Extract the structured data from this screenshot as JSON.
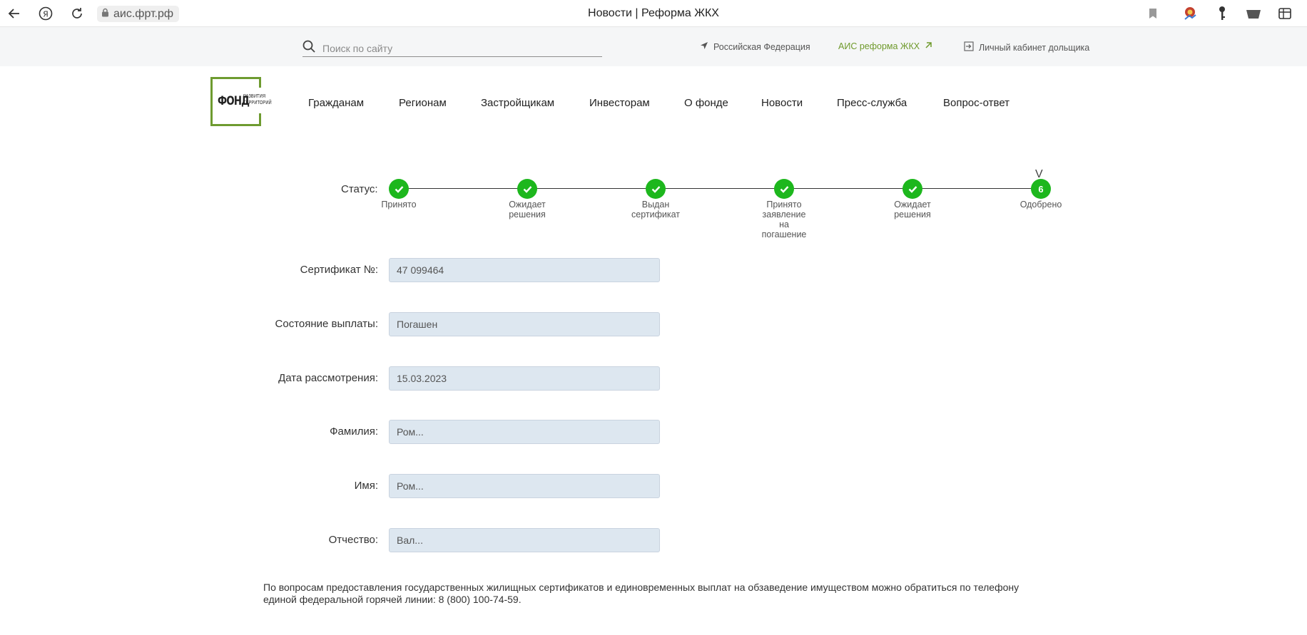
{
  "browser": {
    "url": "аис.фрт.рф",
    "tab_title": "Новости | Реформа ЖКХ",
    "icons": [
      "back-arrow-icon",
      "yandex-icon",
      "reload-icon",
      "lock-icon",
      "bookmark-icon",
      "extension-icon",
      "key-icon",
      "downloads-icon",
      "menu-icon"
    ]
  },
  "topbar": {
    "search_placeholder": "Поиск по сайту",
    "region": "Российская Федерация",
    "ais_link": "АИС реформа ЖКХ",
    "cabinet_link": "Личный кабинет дольщика",
    "colors": {
      "accent_green": "#6f9a2c"
    }
  },
  "header": {
    "logo_word": "ФОНД",
    "logo_sub_1": "РАЗВИТИЯ",
    "logo_sub_2": "ТЕРРИТОРИЙ",
    "nav": [
      "Гражданам",
      "Регионам",
      "Застройщикам",
      "Инвесторам",
      "О фонде",
      "Новости",
      "Пресс-служба",
      "Вопрос-ответ"
    ]
  },
  "status": {
    "label": "Статус:",
    "steps": [
      {
        "label": "Принято",
        "mark": "check"
      },
      {
        "label": "Ожидает решения",
        "mark": "check"
      },
      {
        "label": "Выдан сертификат",
        "mark": "check"
      },
      {
        "label": "Принято заявление на погашение",
        "mark": "check"
      },
      {
        "label": "Ожидает решения",
        "mark": "check"
      },
      {
        "label": "Одобрено",
        "mark": "6"
      }
    ],
    "cursor_glyph": "V",
    "colors": {
      "step_green": "#1db71d"
    }
  },
  "form": {
    "certificate_label": "Сертификат №:",
    "certificate_value": "47 099464",
    "payment_state_label": "Состояние выплаты:",
    "payment_state_value": "Погашен",
    "review_date_label": "Дата рассмотрения:",
    "review_date_value": "15.03.2023",
    "surname_label": "Фамилия:",
    "surname_value": "Ром...",
    "name_label": "Имя:",
    "name_value": "Ром...",
    "patronymic_label": "Отчество:",
    "patronymic_value": "Вал..."
  },
  "footer": {
    "note": "По вопросам предоставления государственных жилищных сертификатов и единовременных выплат на обзаведение имуществом можно обратиться по телефону единой федеральной горячей линии: 8 (800) 100-74-59."
  }
}
